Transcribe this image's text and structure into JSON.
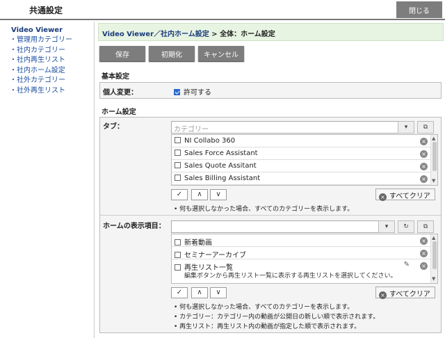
{
  "header": {
    "title": "共通設定",
    "close_label": "閉じる"
  },
  "sidebar": {
    "head": "Video Viewer",
    "items": [
      {
        "label": "管理用カテゴリー"
      },
      {
        "label": "社内カテゴリー"
      },
      {
        "label": "社内再生リスト"
      },
      {
        "label": "社内ホーム設定"
      },
      {
        "label": "社外カテゴリー"
      },
      {
        "label": "社外再生リスト"
      }
    ]
  },
  "breadcrumb": {
    "link": "Video Viewer／社内ホーム設定",
    "separator": ">",
    "current": "全体：ホーム設定"
  },
  "toolbar": {
    "save": "保存",
    "reset": "初期化",
    "cancel": "キャンセル"
  },
  "basic": {
    "title": "基本設定",
    "personal_label": "個人変更：",
    "allow_label": "許可する",
    "allow_checked": true
  },
  "home": {
    "title": "ホーム設定",
    "tab": {
      "label": "タブ：",
      "placeholder": "カテゴリー",
      "items": [
        {
          "label": "NI Collabo 360"
        },
        {
          "label": "Sales Force Assistant"
        },
        {
          "label": "Sales Quote Assitant"
        },
        {
          "label": "Sales Billing Assistant"
        }
      ],
      "clear_all": "すべてクリア",
      "notes": [
        "何も選択しなかった場合、すべてのカテゴリーを表示します。"
      ]
    },
    "display": {
      "label": "ホームの表示項目：",
      "value": "",
      "items": [
        {
          "label": "新着動画"
        },
        {
          "label": "セミナーアーカイブ"
        },
        {
          "label": "再生リスト一覧",
          "sub": "編集ボタンから再生リスト一覧に表示する再生リストを選択してください。"
        }
      ],
      "clear_all": "すべてクリア",
      "notes": [
        "何も選択しなかった場合、すべてのカテゴリーを表示します。",
        "カテゴリー：カテゴリー内の動画が公開日の新しい順で表示されます。",
        "再生リスト：再生リスト内の動画が指定した順で表示されます。"
      ]
    }
  },
  "controls": {
    "check": "✓",
    "up": "∧",
    "down": "∨",
    "dropdown": "▾",
    "copy": "⧉",
    "refresh": "↻",
    "remove": "×",
    "edit": "✎"
  },
  "icons": [
    "chevron-down-icon",
    "copy-icon",
    "refresh-icon",
    "remove-icon",
    "edit-icon",
    "check-icon",
    "arrow-up-icon",
    "arrow-down-icon"
  ],
  "colors": {
    "button_gray": "#7d7d7d",
    "breadcrumb_bg": "#e8f4e2",
    "link_blue": "#1a3c7a",
    "checkbox_blue": "#2a6ad0"
  }
}
